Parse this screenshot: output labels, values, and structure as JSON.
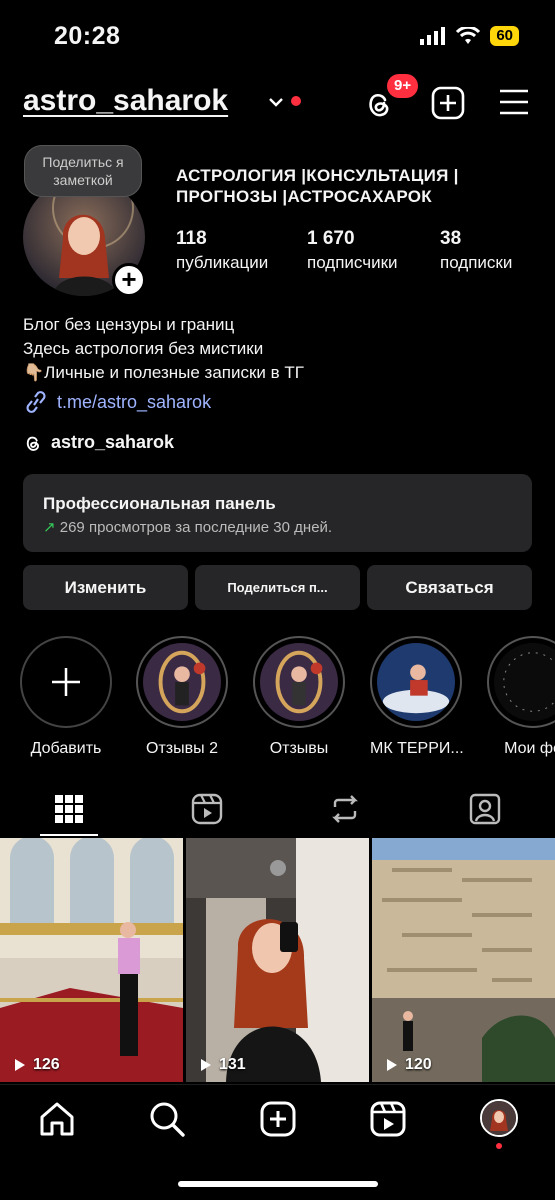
{
  "status_bar": {
    "time": "20:28",
    "battery": "60"
  },
  "header": {
    "username": "astro_saharok",
    "threads_badge": "9+"
  },
  "profile": {
    "note": "Поделитьс я заметкой",
    "full_name_line1": "АСТРОЛОГИЯ |КОНСУЛЬТАЦИЯ |",
    "full_name_line2": "ПРОГНОЗЫ |АСТРОСАХАРОК",
    "stats": [
      {
        "num": "118",
        "label": "публикации"
      },
      {
        "num": "1 670",
        "label": "подписчики"
      },
      {
        "num": "38",
        "label": "подписки"
      }
    ],
    "bio": [
      "Блог без цензуры и границ",
      "Здесь астрология без мистики",
      "👇🏼Личные и полезные записки в ТГ"
    ],
    "link": "t.me/astro_saharok",
    "threads_handle": "astro_saharok"
  },
  "pro_panel": {
    "title": "Профессиональная панель",
    "subtitle": "269 просмотров за последние 30 дней."
  },
  "buttons": {
    "edit": "Изменить",
    "share": "Поделиться п...",
    "contact": "Связаться"
  },
  "highlights": [
    "Добавить",
    "Отзывы 2",
    "Отзывы",
    "МК ТЕРРИ...",
    "Мои фе"
  ],
  "tabs": [
    "grid-icon",
    "reels-icon",
    "reposts-icon",
    "tagged-icon"
  ],
  "posts": [
    {
      "views": "126"
    },
    {
      "views": "131"
    },
    {
      "views": "120"
    }
  ],
  "nav": [
    "home-icon",
    "search-icon",
    "create-icon",
    "reels-icon",
    "profile-avatar"
  ],
  "colors": {
    "accent_red": "#ff2f40",
    "link_blue": "#9fb4ff",
    "battery_yellow": "#ffd60a",
    "growth_green": "#35c759"
  }
}
